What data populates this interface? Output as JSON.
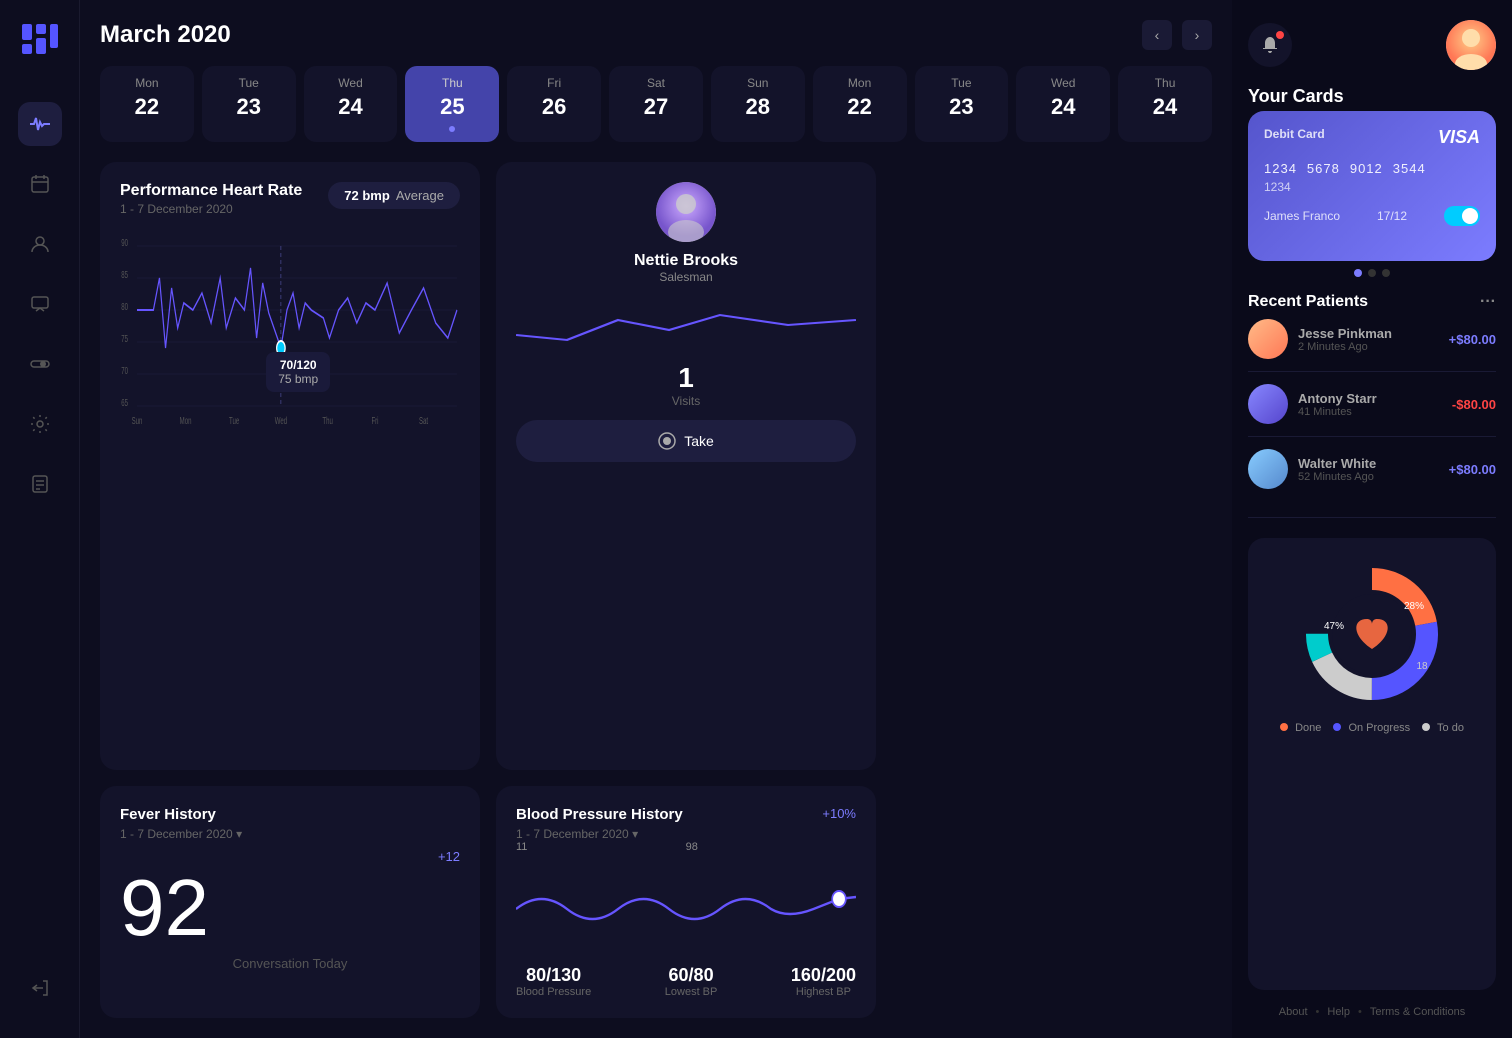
{
  "sidebar": {
    "logo_alt": "App Logo",
    "items": [
      {
        "id": "heartrate",
        "icon": "⚡",
        "active": true
      },
      {
        "id": "calendar",
        "icon": "▦"
      },
      {
        "id": "profile",
        "icon": "👤"
      },
      {
        "id": "messages",
        "icon": "💬"
      },
      {
        "id": "toggle",
        "icon": "◉"
      },
      {
        "id": "settings",
        "icon": "⚙"
      },
      {
        "id": "notes",
        "icon": "📋"
      }
    ],
    "logout_icon": "⏻"
  },
  "header": {
    "month": "March 2020",
    "prev_arrow": "‹",
    "next_arrow": "›"
  },
  "calendar": {
    "days": [
      {
        "name": "Mon",
        "num": "22"
      },
      {
        "name": "Tue",
        "num": "23"
      },
      {
        "name": "Wed",
        "num": "24"
      },
      {
        "name": "Thu",
        "num": "25",
        "active": true,
        "dot": true
      },
      {
        "name": "Fri",
        "num": "26"
      },
      {
        "name": "Sat",
        "num": "27"
      },
      {
        "name": "Sun",
        "num": "28"
      },
      {
        "name": "Mon",
        "num": "22"
      },
      {
        "name": "Tue",
        "num": "23"
      },
      {
        "name": "Wed",
        "num": "24"
      },
      {
        "name": "Thu",
        "num": "24"
      }
    ]
  },
  "heart_rate_chart": {
    "title": "Performance Heart Rate",
    "date_range": "1 - 7 December 2020",
    "avg_label": "Average",
    "avg_value": "72 bmp",
    "tooltip_line1": "70/120",
    "tooltip_line2": "75 bmp",
    "x_labels": [
      "Sun",
      "Mon",
      "Tue",
      "Wed",
      "Thu",
      "Fri",
      "Sat"
    ],
    "y_labels": [
      "90",
      "85",
      "80",
      "75",
      "70",
      "65"
    ]
  },
  "patient_card": {
    "name": "Nettie Brooks",
    "role": "Salesman",
    "visits_num": "1",
    "visits_label": "Visits",
    "take_btn": "Take"
  },
  "fever_card": {
    "title": "Fever History",
    "date_range": "1 - 7 December 2020",
    "change": "+12",
    "value": "92",
    "label": "Conversation Today"
  },
  "bp_card": {
    "title": "Blood Pressure History",
    "date_range": "1 - 7 December 2020",
    "change": "+10%",
    "label1_val": "11",
    "label2_val": "98",
    "stat1_val": "80/130",
    "stat1_label": "Blood Pressure",
    "stat2_val": "60/80",
    "stat2_label": "Lowest BP",
    "stat3_val": "160/200",
    "stat3_label": "Highest BP"
  },
  "far_right": {
    "cards_title": "Your Cards",
    "debit_label": "Debit Card",
    "visa": "VISA",
    "card_num1": "1234",
    "card_num2": "5678",
    "card_num3": "9012",
    "card_num4": "3544",
    "card_num_row2": "1234",
    "card_holder": "James Franco",
    "card_expiry": "17/12",
    "recent_title": "Recent Patients",
    "patients": [
      {
        "name": "Jesse Pinkman",
        "time": "2 Minutes Ago",
        "amount": "+$80.00",
        "positive": true
      },
      {
        "name": "Antony Starr",
        "time": "41 Minutes",
        "amount": "-$80.00",
        "positive": false
      },
      {
        "name": "Walter White",
        "time": "52 Minutes Ago",
        "amount": "+$80.00",
        "positive": true
      }
    ],
    "donut": {
      "segments": [
        {
          "label": "Done",
          "color": "#ff7043",
          "pct": 47,
          "offset": 0
        },
        {
          "label": "On Progress",
          "color": "#5555ff",
          "pct": 28,
          "offset": 47
        },
        {
          "label": "To do",
          "color": "#e0e0e0",
          "pct": 18,
          "offset": 75
        }
      ],
      "label_47": "47%",
      "label_28": "28%",
      "label_18": "18"
    },
    "footer": {
      "about": "About",
      "help": "Help",
      "terms": "Terms & Conditions"
    }
  }
}
